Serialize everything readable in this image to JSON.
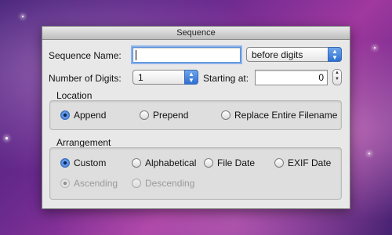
{
  "window": {
    "title": "Sequence"
  },
  "sequence_name": {
    "label": "Sequence Name:",
    "value": ""
  },
  "position_popup": {
    "value": "before digits"
  },
  "digits": {
    "label": "Number of Digits:",
    "value": "1"
  },
  "starting": {
    "label": "Starting at:",
    "value": "0"
  },
  "location": {
    "title": "Location",
    "options": [
      "Append",
      "Prepend",
      "Replace Entire Filename"
    ],
    "selected": "Append"
  },
  "arrangement": {
    "title": "Arrangement",
    "options": [
      "Custom",
      "Alphabetical",
      "File Date",
      "EXIF Date"
    ],
    "selected": "Custom",
    "order_options": [
      "Ascending",
      "Descending"
    ],
    "order_selected": "Ascending",
    "order_enabled": false
  },
  "colors": {
    "accent": "#2f6fd3",
    "window_bg": "#e8e8e8"
  }
}
